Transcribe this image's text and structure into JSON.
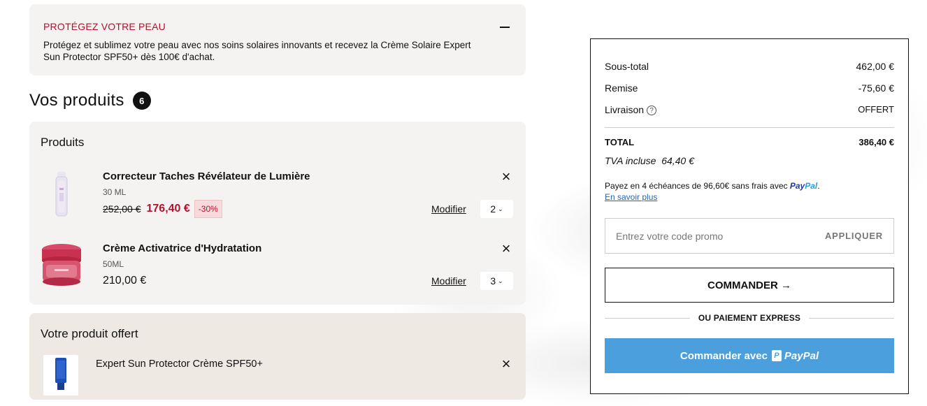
{
  "banner": {
    "title": "PROTÉGEZ VOTRE PEAU",
    "text": "Protégez et sublimez votre peau avec nos soins solaires innovants et recevez la Crème Solaire Expert Sun Protector SPF50+ dès 100€ d'achat."
  },
  "products": {
    "heading": "Vos produits",
    "count": "6",
    "box_title": "Produits",
    "modify_label": "Modifier",
    "items": [
      {
        "name": "Correcteur Taches Révélateur de Lumière",
        "size": "30 ML",
        "old_price": "252,00 €",
        "price": "176,40 €",
        "discount": "-30%",
        "quantity": "2"
      },
      {
        "name": "Crème Activatrice d'Hydratation",
        "size": "50ML",
        "price": "210,00 €",
        "quantity": "3"
      }
    ]
  },
  "gift": {
    "title": "Votre produit offert",
    "name": "Expert Sun Protector Crème SPF50+"
  },
  "summary": {
    "subtotal_label": "Sous-total",
    "subtotal_value": "462,00 €",
    "discount_label": "Remise",
    "discount_value": "-75,60 €",
    "shipping_label": "Livraison",
    "shipping_value": "OFFERT",
    "total_label": "TOTAL",
    "total_value": "386,40 €",
    "tva_label": "TVA incluse",
    "tva_value": "64,40 €",
    "paypal_text": "Payez en 4 échéances de 96,60€ sans frais avec",
    "paypal_brand_1": "Pay",
    "paypal_brand_2": "Pal",
    "learn_more": "En savoir plus",
    "promo_placeholder": "Entrez votre code promo",
    "apply_label": "APPLIQUER",
    "order_label": "COMMANDER →",
    "express_label": "OU PAIEMENT EXPRESS",
    "paypal_button_label": "Commander avec",
    "paypal_button_brand": "PayPal"
  },
  "icons": {
    "collapse": "minus-icon",
    "remove": "close-icon",
    "help": "question-circle-icon",
    "chevron": "chevron-down-icon"
  },
  "colors": {
    "accent": "#b3122e",
    "paypal_button": "#4a9fdc",
    "panel_bg": "#f4f3f2",
    "gift_bg": "#efe9e3"
  }
}
